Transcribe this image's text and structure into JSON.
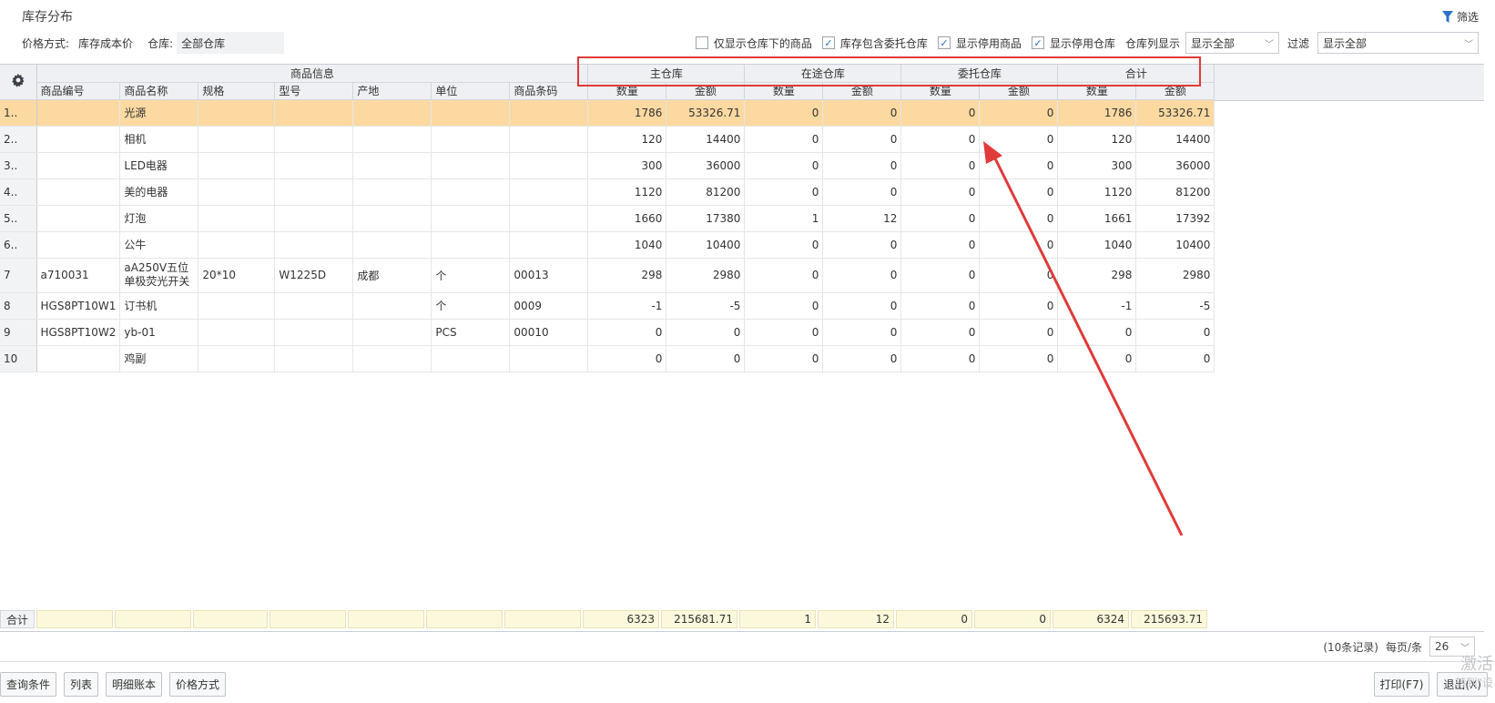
{
  "page": {
    "title": "库存分布",
    "filter_label": "筛选"
  },
  "toolbar": {
    "price_label": "价格方式:",
    "price_value": "库存成本价",
    "warehouse_label": "仓库:",
    "warehouse_value": "全部仓库",
    "options": [
      {
        "label": "仅显示仓库下的商品",
        "checked": false
      },
      {
        "label": "库存包含委托仓库",
        "checked": true
      },
      {
        "label": "显示停用商品",
        "checked": true
      },
      {
        "label": "显示停用仓库",
        "checked": true
      }
    ],
    "column_display_label": "仓库列显示",
    "column_display_value": "显示全部",
    "filter_label": "过滤",
    "filter_value": "显示全部"
  },
  "grid": {
    "group_headers": {
      "info": "商品信息",
      "main": "主仓库",
      "transit": "在途仓库",
      "consign": "委托仓库",
      "total": "合计"
    },
    "columns": [
      "商品编号",
      "商品名称",
      "规格",
      "型号",
      "产地",
      "单位",
      "商品条码",
      "数量",
      "金额",
      "数量",
      "金额",
      "数量",
      "金额",
      "数量",
      "金额"
    ],
    "rows": [
      {
        "idx": "1..",
        "code": "",
        "name": "光源",
        "spec": "",
        "model": "",
        "origin": "",
        "unit": "",
        "barcode": "",
        "v": [
          "1786",
          "53326.71",
          "0",
          "0",
          "0",
          "0",
          "1786",
          "53326.71"
        ]
      },
      {
        "idx": "2..",
        "code": "",
        "name": "相机",
        "spec": "",
        "model": "",
        "origin": "",
        "unit": "",
        "barcode": "",
        "v": [
          "120",
          "14400",
          "0",
          "0",
          "0",
          "0",
          "120",
          "14400"
        ]
      },
      {
        "idx": "3..",
        "code": "",
        "name": "LED电器",
        "spec": "",
        "model": "",
        "origin": "",
        "unit": "",
        "barcode": "",
        "v": [
          "300",
          "36000",
          "0",
          "0",
          "0",
          "0",
          "300",
          "36000"
        ]
      },
      {
        "idx": "4..",
        "code": "",
        "name": "美的电器",
        "spec": "",
        "model": "",
        "origin": "",
        "unit": "",
        "barcode": "",
        "v": [
          "1120",
          "81200",
          "0",
          "0",
          "0",
          "0",
          "1120",
          "81200"
        ]
      },
      {
        "idx": "5..",
        "code": "",
        "name": "灯泡",
        "spec": "",
        "model": "",
        "origin": "",
        "unit": "",
        "barcode": "",
        "v": [
          "1660",
          "17380",
          "1",
          "12",
          "0",
          "0",
          "1661",
          "17392"
        ]
      },
      {
        "idx": "6..",
        "code": "",
        "name": "公牛",
        "spec": "",
        "model": "",
        "origin": "",
        "unit": "",
        "barcode": "",
        "v": [
          "1040",
          "10400",
          "0",
          "0",
          "0",
          "0",
          "1040",
          "10400"
        ]
      },
      {
        "idx": "7",
        "code": "a710031",
        "name": "aA250V五位单极荧光开关",
        "spec": "20*10",
        "model": "W1225D",
        "origin": "成都",
        "unit": "个",
        "barcode": "00013",
        "v": [
          "298",
          "2980",
          "0",
          "0",
          "0",
          "0",
          "298",
          "2980"
        ]
      },
      {
        "idx": "8",
        "code": "HGS8PT10W1",
        "name": "订书机",
        "spec": "",
        "model": "",
        "origin": "",
        "unit": "个",
        "barcode": "0009",
        "v": [
          "-1",
          "-5",
          "0",
          "0",
          "0",
          "0",
          "-1",
          "-5"
        ]
      },
      {
        "idx": "9",
        "code": "HGS8PT10W2",
        "name": "yb-01",
        "spec": "",
        "model": "",
        "origin": "",
        "unit": "PCS",
        "barcode": "00010",
        "v": [
          "0",
          "0",
          "0",
          "0",
          "0",
          "0",
          "0",
          "0"
        ]
      },
      {
        "idx": "10",
        "code": "",
        "name": "鸡副",
        "spec": "",
        "model": "",
        "origin": "",
        "unit": "",
        "barcode": "",
        "v": [
          "0",
          "0",
          "0",
          "0",
          "0",
          "0",
          "0",
          "0"
        ]
      }
    ],
    "totals": {
      "label": "合计",
      "v": [
        "6323",
        "215681.71",
        "1",
        "12",
        "0",
        "0",
        "6324",
        "215693.71"
      ]
    }
  },
  "pager": {
    "records": "(10条记录)",
    "per_page_label": "每页/条",
    "per_page_value": "26"
  },
  "buttons": {
    "query": "查询条件",
    "list": "列表",
    "detail": "明细账本",
    "price": "价格方式",
    "print": "打印(F7)",
    "exit": "退出(X)"
  },
  "watermark": {
    "line1": "激活",
    "line2": "转到\"设"
  },
  "colors": {
    "selected_row": "#fcd9a1",
    "total_row": "#fbf8dc",
    "annotation": "#e03a3a",
    "check": "#2a71c9"
  }
}
